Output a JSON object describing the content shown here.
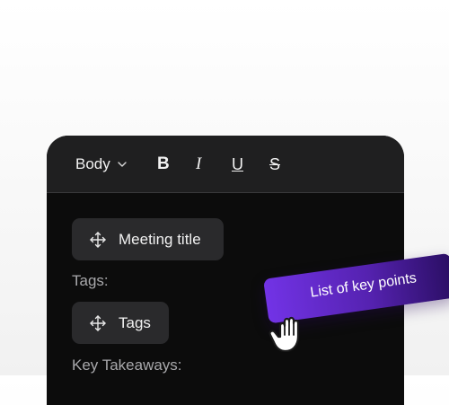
{
  "toolbar": {
    "style_select_label": "Body",
    "bold_label": "B",
    "italic_label": "I",
    "underline_label": "U",
    "strike_label": "S"
  },
  "content": {
    "meeting_title_chip": "Meeting title",
    "tags_label": "Tags:",
    "tags_chip": "Tags",
    "key_takeaways_label": "Key Takeaways:"
  },
  "drag_item": {
    "label": "List of key points"
  },
  "icons": {
    "style_select": "chevron-down-icon",
    "chip": "move-arrows-icon",
    "cursor": "grab-hand-icon"
  },
  "colors": {
    "panel_background": "#0c0c0c",
    "toolbar_background": "#1f1f20",
    "chip_background": "#2a2a2c",
    "label_text": "#a8a8ab",
    "drag_gradient_start": "#7233e6",
    "drag_gradient_end": "#2a0e63"
  }
}
